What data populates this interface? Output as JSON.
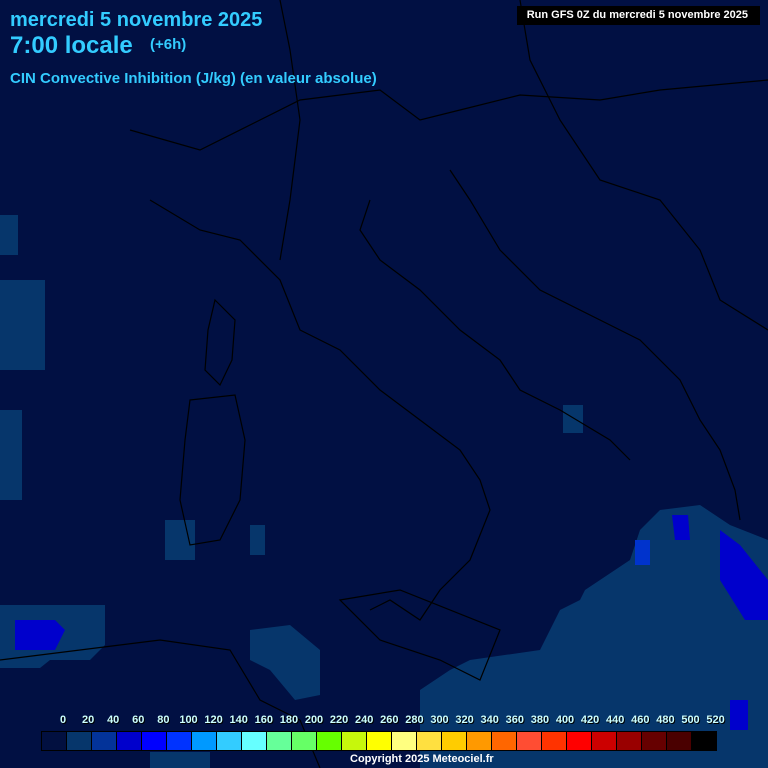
{
  "header": {
    "date": "mercredi 5 novembre 2025",
    "time": "7:00 locale",
    "lead": "(+6h)",
    "parameter": "CIN Convective Inhibition (J/kg) (en valeur absolue)",
    "run": "Run GFS 0Z du mercredi 5 novembre 2025"
  },
  "legend": {
    "labels": [
      "0",
      "20",
      "40",
      "60",
      "80",
      "100",
      "120",
      "140",
      "160",
      "180",
      "200",
      "220",
      "240",
      "260",
      "280",
      "300",
      "320",
      "340",
      "360",
      "380",
      "400",
      "420",
      "440",
      "460",
      "480",
      "500",
      "520"
    ],
    "colors": [
      "#021040",
      "#06366b",
      "#033399",
      "#0000cc",
      "#0000ff",
      "#0033ff",
      "#0099ff",
      "#33ccff",
      "#66ffff",
      "#66ff99",
      "#66ff66",
      "#66ff00",
      "#c6f70c",
      "#ffff00",
      "#ffff80",
      "#ffe040",
      "#ffcc00",
      "#ff9900",
      "#ff6600",
      "#ff4d33",
      "#ff3300",
      "#ff0000",
      "#cc0000",
      "#990000",
      "#660000",
      "#4a0000",
      "#000000"
    ]
  },
  "copyright": "Copyright 2025 Meteociel.fr"
}
